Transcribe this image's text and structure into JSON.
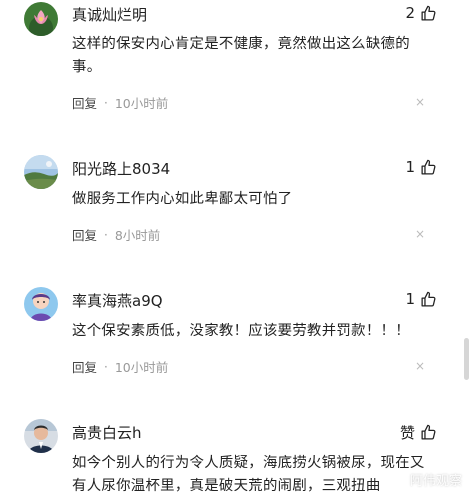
{
  "comments": [
    {
      "username": "真诚灿烂明",
      "likes": "2",
      "text": "这样的保安内心肯定是不健康，竟然做出这么缺德的事。",
      "reply_label": "回复",
      "time": "10小时前",
      "close": "×"
    },
    {
      "username": "阳光路上8034",
      "likes": "1",
      "text": "做服务工作内心如此卑鄙太可怕了",
      "reply_label": "回复",
      "time": "8小时前",
      "close": "×"
    },
    {
      "username": "率真海燕a9Q",
      "likes": "1",
      "text": "这个保安素质低，没家教！应该要劳教并罚款！！！",
      "reply_label": "回复",
      "time": "10小时前",
      "close": "×"
    },
    {
      "username": "高贵白云h",
      "likes": "赞",
      "text": "如今个别人的行为令人质疑，海底捞火锅被尿，现在又有人尿你温杯里，真是破天荒的闹剧，三观扭曲",
      "reply_label": "",
      "time": "",
      "close": ""
    }
  ],
  "separator": "·",
  "watermark": "阿伟观察",
  "icons": {
    "like": "thumbs-up-icon",
    "close": "close-icon"
  },
  "colors": {
    "text": "#222222",
    "meta": "#999999",
    "close": "#bbbbbb"
  }
}
